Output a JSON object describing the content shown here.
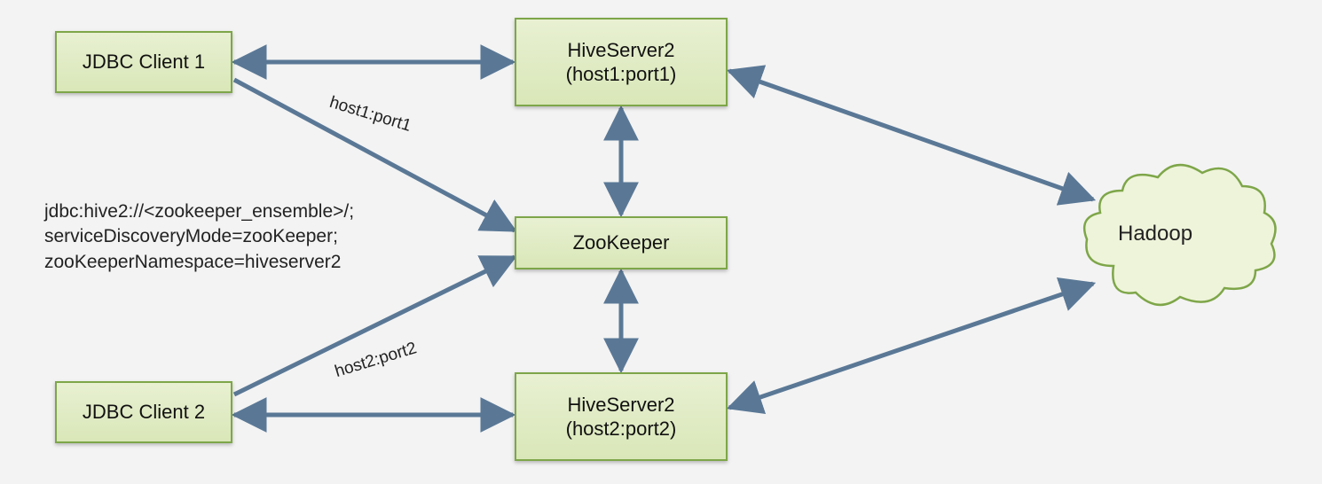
{
  "nodes": {
    "jdbc1": "JDBC Client 1",
    "jdbc2": "JDBC Client 2",
    "hiveserver1_line1": "HiveServer2",
    "hiveserver1_line2": "(host1:port1)",
    "hiveserver2_line1": "HiveServer2",
    "hiveserver2_line2": "(host2:port2)",
    "zookeeper": "ZooKeeper",
    "hadoop": "Hadoop"
  },
  "edge_labels": {
    "host1port1": "host1:port1",
    "host2port2": "host2:port2"
  },
  "jdbc_url": "jdbc:hive2://<zookeeper_ensemble>/;\nserviceDiscoveryMode=zooKeeper;\nzooKeeperNamespace=hiveserver2",
  "edges_description": [
    "JDBC Client 1 ↔ HiveServer2 (host1:port1)",
    "JDBC Client 2 ↔ HiveServer2 (host2:port2)",
    "JDBC Client 1 → ZooKeeper (label host1:port1)",
    "JDBC Client 2 → ZooKeeper (label host2:port2)",
    "HiveServer2 (host1:port1) ↔ ZooKeeper",
    "HiveServer2 (host2:port2) ↔ ZooKeeper",
    "HiveServer2 (host1:port1) ↔ Hadoop",
    "HiveServer2 (host2:port2) ↔ Hadoop"
  ],
  "colors": {
    "box_fill_top": "#e8f0d2",
    "box_fill_bottom": "#d9e7b8",
    "box_border": "#7ea649",
    "connector": "#5a7896",
    "cloud_fill": "#eef4da",
    "cloud_border": "#7ea649"
  }
}
